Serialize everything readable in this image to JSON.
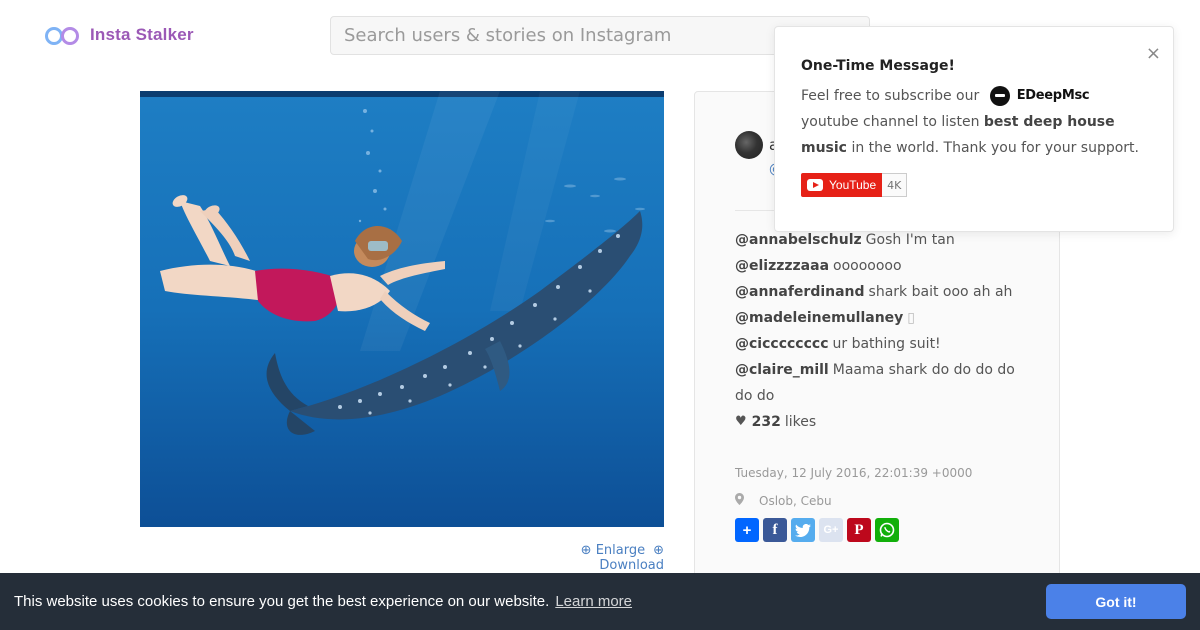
{
  "header": {
    "brand": "Insta Stalker",
    "search_placeholder": "Search users & stories on Instagram"
  },
  "photo": {
    "alt": "Swimmer with whale shark underwater",
    "enlarge_label": "Enlarge",
    "download_label": "Download"
  },
  "post": {
    "owner_name": "a",
    "owner_handle": "@",
    "comments": [
      {
        "user": "@annabelschulz",
        "text": "Gosh I'm tan"
      },
      {
        "user": "@elizzzzaaa",
        "text": "oooooooo"
      },
      {
        "user": "@annaferdinand",
        "text": "shark bait ooo ah ah"
      },
      {
        "user": "@madeleinemullaney",
        "text": "▯"
      },
      {
        "user": "@cicccccccc",
        "text": "ur bathing suit!"
      },
      {
        "user": "@claire_mill",
        "text": "Maama shark do do do do do do"
      }
    ],
    "likes_count": "232",
    "likes_label": "likes",
    "date": "Tuesday, 12 July 2016, 22:01:39 +0000",
    "location": "Oslob, Cebu",
    "share_icons": [
      "add-share-icon",
      "facebook-icon",
      "twitter-icon",
      "google-plus-icon",
      "pinterest-icon",
      "whatsapp-icon"
    ],
    "share_colors": {
      "add": "#0166ff",
      "facebook": "#3b5998",
      "twitter": "#55acee",
      "google_plus": "#dce3f0",
      "pinterest": "#bd081c",
      "whatsapp": "#12af0a"
    }
  },
  "popup": {
    "title": "One-Time Message!",
    "text_before": "Feel free to subscribe our",
    "brand_name": "EDeepMsc",
    "text_after": "youtube channel to listen",
    "bold_phrase": "best deep house music",
    "text_end": "in the world. Thank you for your support.",
    "youtube_label": "YouTube",
    "youtube_count": "4K",
    "close_label": "×"
  },
  "cookie": {
    "message": "This website uses cookies to ensure you get the best experience on our website.",
    "learn_more": "Learn more",
    "button": "Got it!"
  },
  "colors": {
    "brand": "#9b59b6",
    "link": "#4a7fc1",
    "cookie_bg": "#252e39",
    "cookie_button": "#4b81e8",
    "youtube_red": "#e62117"
  }
}
